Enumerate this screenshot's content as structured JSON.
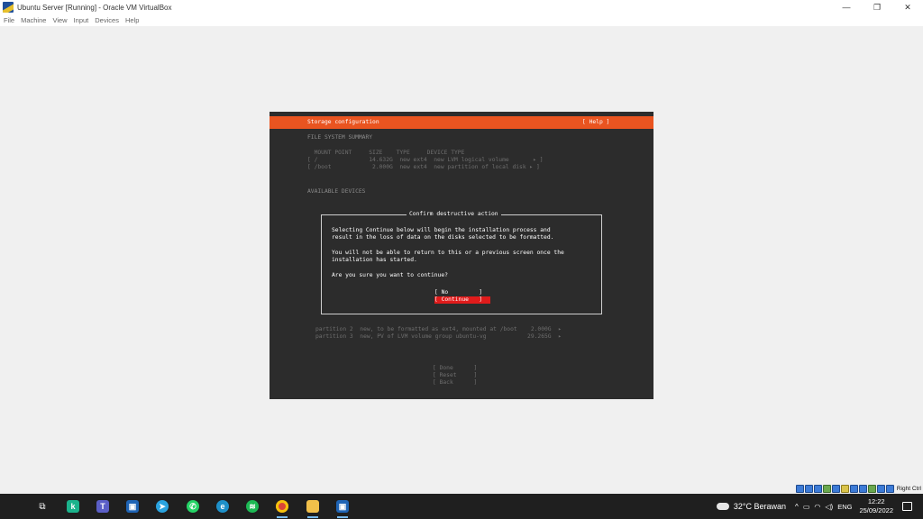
{
  "window": {
    "title": "Ubuntu Server [Running] - Oracle VM VirtualBox",
    "minimize": "—",
    "restore": "❐",
    "close": "✕"
  },
  "menu": [
    "File",
    "Machine",
    "View",
    "Input",
    "Devices",
    "Help"
  ],
  "vm": {
    "header_title": "Storage configuration",
    "header_help": "[ Help ]",
    "fs_summary_title": "FILE SYSTEM SUMMARY",
    "fs_columns": "  MOUNT POINT     SIZE    TYPE     DEVICE TYPE",
    "fs_rows": [
      "[ /               14.632G  new ext4  new LVM logical volume       ▸ ]",
      "[ /boot            2.000G  new ext4  new partition of local disk ▸ ]"
    ],
    "available_devices_title": "AVAILABLE DEVICES",
    "partition_rows": [
      "partition 2  new, to be formatted as ext4, mounted at /boot    2.000G  ▸",
      "partition 3  new, PV of LVM volume group ubuntu-vg            29.265G  ▸"
    ],
    "nav_buttons": [
      "[ Done      ]",
      "[ Reset     ]",
      "[ Back      ]"
    ],
    "dialog": {
      "title": "Confirm destructive action",
      "lines": [
        "Selecting Continue below will begin the installation process and",
        "result in the loss of data on the disks selected to be formatted.",
        "You will not be able to return to this or a previous screen once the",
        "installation has started.",
        "Are you sure you want to continue?"
      ],
      "no_label": "[ No         ]",
      "continue_label": "[ Continue   ]"
    }
  },
  "status_bar": {
    "host_key": "Right Ctrl"
  },
  "taskbar": {
    "apps": [
      "start-icon",
      "task-view-icon",
      "kite-icon",
      "teams-icon",
      "virtualbox-icon",
      "telegram-icon",
      "whatsapp-icon",
      "edge-icon",
      "spotify-icon",
      "chrome-icon",
      "file-explorer-icon",
      "virtualbox-active-icon"
    ],
    "weather": "32°C Berawan",
    "tray_chevron": "^",
    "lang": "ENG",
    "time": "12:22",
    "date": "25/09/2022"
  }
}
